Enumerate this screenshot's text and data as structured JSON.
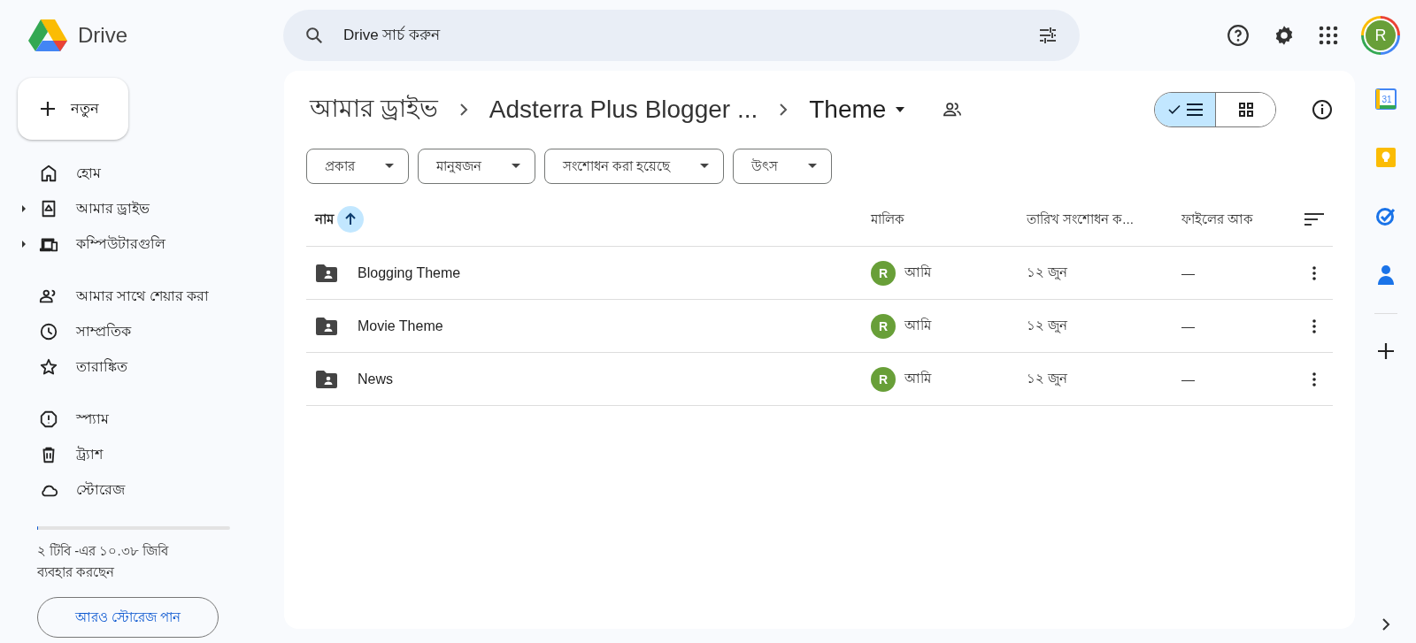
{
  "app": {
    "name": "Drive"
  },
  "search": {
    "placeholder": "Drive সার্চ করুন"
  },
  "account": {
    "initial": "R"
  },
  "new_button": {
    "label": "নতুন"
  },
  "sidebar": {
    "groups": [
      [
        {
          "label": "হোম",
          "expandable": false,
          "selected": false
        },
        {
          "label": "আমার ড্রাইভ",
          "expandable": true,
          "selected": false
        },
        {
          "label": "কম্পিউটারগুলি",
          "expandable": true,
          "selected": false
        }
      ],
      [
        {
          "label": "আমার সাথে শেয়ার করা",
          "expandable": false,
          "selected": false
        },
        {
          "label": "সাম্প্রতিক",
          "expandable": false,
          "selected": false
        },
        {
          "label": "তারাঙ্কিত",
          "expandable": false,
          "selected": false
        }
      ],
      [
        {
          "label": "স্প্যাম",
          "expandable": false,
          "selected": false
        },
        {
          "label": "ট্র্যাশ",
          "expandable": false,
          "selected": false
        },
        {
          "label": "স্টোরেজ",
          "expandable": false,
          "selected": false
        }
      ]
    ]
  },
  "storage": {
    "level": 0.005,
    "text": "২ টিবি -এর ১০.৩৮ জিবি ব্যবহার করছেন",
    "button": "আরও স্টোরেজ পান"
  },
  "breadcrumbs": [
    "আমার ড্রাইভ",
    "Adsterra Plus Blogger ...",
    "Theme"
  ],
  "view_toggle": [
    {
      "kind": "list",
      "selected": true
    },
    {
      "kind": "grid",
      "selected": false
    }
  ],
  "filters": [
    "প্রকার",
    "মানুষজন",
    "সংশোধন করা হয়েছে",
    "উৎস"
  ],
  "table": {
    "columns": [
      {
        "label": "নাম",
        "sorted": true
      },
      {
        "label": "মালিক",
        "sorted": false
      },
      {
        "label": "তারিখ সংশোধন ক...",
        "sorted": false
      },
      {
        "label": "ফাইলের আক",
        "sorted": false
      }
    ],
    "rows": [
      {
        "name": "Blogging Theme",
        "owner_initial": "R",
        "owner": "আমি",
        "modified": "১২ জুন",
        "size": "—"
      },
      {
        "name": "Movie Theme",
        "owner_initial": "R",
        "owner": "আমি",
        "modified": "১২ জুন",
        "size": "—"
      },
      {
        "name": "News",
        "owner_initial": "R",
        "owner": "আমি",
        "modified": "১২ জুন",
        "size": "—"
      }
    ]
  },
  "side_apps": {
    "calendar_day": "31"
  }
}
